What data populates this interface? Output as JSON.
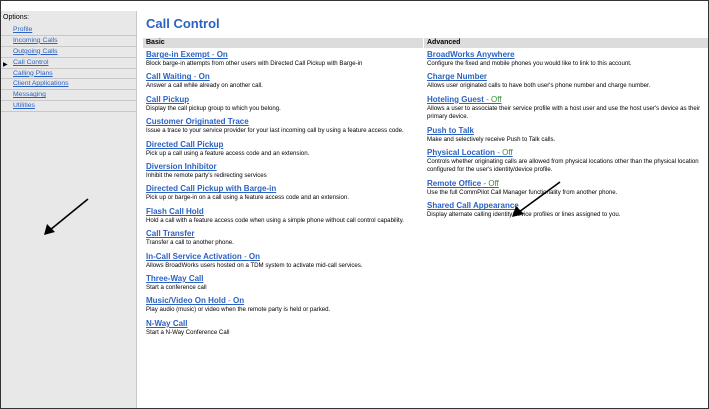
{
  "sidebar": {
    "heading": "Options:",
    "items": [
      {
        "label": "Profile",
        "current": false
      },
      {
        "label": "Incoming Calls",
        "current": false
      },
      {
        "label": "Outgoing Calls",
        "current": false
      },
      {
        "label": "Call Control",
        "current": true
      },
      {
        "label": "Calling Plans",
        "current": false
      },
      {
        "label": "Client Applications",
        "current": false
      },
      {
        "label": "Messaging",
        "current": false
      },
      {
        "label": "Utilities",
        "current": false
      }
    ],
    "current_marker_icon": "triangle-right-icon"
  },
  "page": {
    "title": "Call Control"
  },
  "basic": {
    "header": "Basic",
    "features": [
      {
        "name": "Barge-in Exempt",
        "status": "On",
        "description": "Block barge-in attempts from other users with Directed Call Pickup with Barge-in"
      },
      {
        "name": "Call Waiting",
        "status": "On",
        "description": "Answer a call while already on another call."
      },
      {
        "name": "Call Pickup",
        "status": "",
        "description": "Display the call pickup group to which you belong."
      },
      {
        "name": "Customer Originated Trace",
        "status": "",
        "description": "Issue a trace to your service provider for your last incoming call by using a feature access code."
      },
      {
        "name": "Directed Call Pickup",
        "status": "",
        "description": "Pick up a call using a feature access code and an extension."
      },
      {
        "name": "Diversion Inhibitor",
        "status": "",
        "description": "Inhibit the remote party's redirecting services"
      },
      {
        "name": "Directed Call Pickup with Barge-in",
        "status": "",
        "description": "Pick up or barge-in on a call using a feature access code and an extension."
      },
      {
        "name": "Flash Call Hold",
        "status": "",
        "description": "Hold a call with a feature access code when using a simple phone without call control capability."
      },
      {
        "name": "Call Transfer",
        "status": "",
        "description": "Transfer a call to another phone."
      },
      {
        "name": "In-Call Service Activation",
        "status": "On",
        "description": "Allows BroadWorks users hosted on a TDM system to activate mid-call services."
      },
      {
        "name": "Three-Way Call",
        "status": "",
        "description": "Start a conference call"
      },
      {
        "name": "Music/Video On Hold",
        "status": "On",
        "description": "Play audio (music) or video when the remote party is held or parked."
      },
      {
        "name": "N-Way Call",
        "status": "",
        "description": "Start a N-Way Conference Call"
      }
    ]
  },
  "advanced": {
    "header": "Advanced",
    "features": [
      {
        "name": "BroadWorks Anywhere",
        "status": "",
        "description": "Configure the fixed and mobile phones you would like to link to this account."
      },
      {
        "name": "Charge Number",
        "status": "",
        "description": "Allows user originated calls to have both user's phone number and charge number."
      },
      {
        "name": "Hoteling Guest",
        "status": "Off",
        "description": "Allows a user to associate their service profile with a host user and use the host user's device as their primary device."
      },
      {
        "name": "Push to Talk",
        "status": "",
        "description": "Make and selectively receive Push to Talk calls."
      },
      {
        "name": "Physical Location",
        "status": "Off",
        "description": "Controls whether originating calls are allowed from physical locations other than the physical location configured for the user's identity/device profile."
      },
      {
        "name": "Remote Office",
        "status": "Off",
        "description": "Use the full CommPilot Call Manager functionality from another phone."
      },
      {
        "name": "Shared Call Appearance",
        "status": "",
        "description": "Display alternate calling identity/device profiles or lines assigned to you."
      }
    ]
  },
  "colors": {
    "link": "#2b62c4",
    "status_off": "#3a8a3a",
    "sidebar_bg": "#e8e8e8",
    "section_header_bg": "#dcdcdc",
    "annotation_arrow": "#000000"
  },
  "annotations": [
    {
      "name": "annotation-arrow-left",
      "icon": "arrow-down-left-icon"
    },
    {
      "name": "annotation-arrow-right",
      "icon": "arrow-down-left-icon"
    }
  ]
}
